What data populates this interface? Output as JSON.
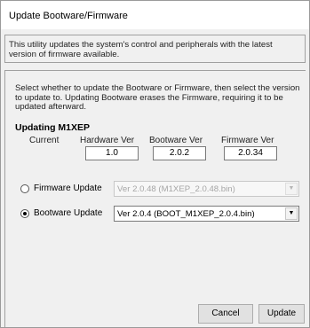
{
  "window": {
    "title": "Update Bootware/Firmware"
  },
  "intro": {
    "text": "This utility updates the system's control and peripherals with the latest version of firmware available."
  },
  "instructions": {
    "text": "Select whether to update the Bootware or Firmware, then select the version to update to.  Updating Bootware erases the Firmware, requiring it to be updated afterward."
  },
  "device": {
    "heading": "Updating M1XEP",
    "current_label": "Current",
    "hardware_label": "Hardware Ver",
    "hardware_value": "1.0",
    "bootware_label": "Bootware Ver",
    "bootware_value": "2.0.2",
    "firmware_label": "Firmware Ver",
    "firmware_value": "2.0.34"
  },
  "options": {
    "firmware": {
      "label": "Firmware Update",
      "selected": false,
      "version": "Ver 2.0.48 (M1XEP_2.0.48.bin)"
    },
    "bootware": {
      "label": "Bootware Update",
      "selected": true,
      "version": "Ver 2.0.4 (BOOT_M1XEP_2.0.4.bin)"
    }
  },
  "buttons": {
    "cancel": "Cancel",
    "update": "Update"
  },
  "icons": {
    "dropdown": "chevron-down-icon"
  }
}
